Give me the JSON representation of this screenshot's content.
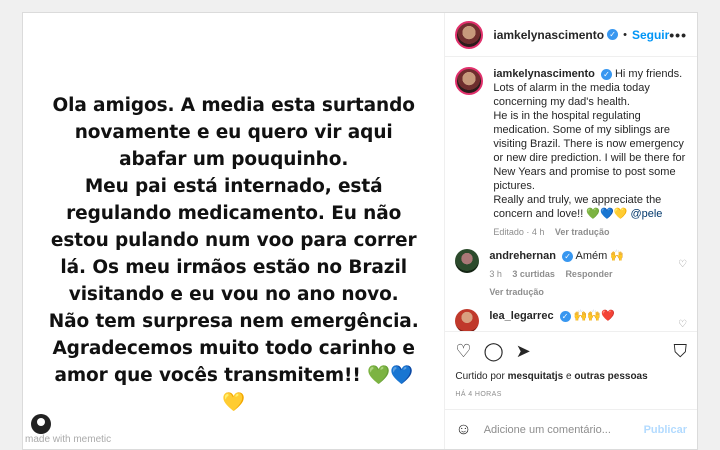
{
  "post": {
    "lines": [
      "Ola amigos. A media esta surtando",
      "novamente e eu quero vir aqui",
      "abafar um pouquinho.",
      "Meu pai está internado, está",
      "regulando medicamento. Eu não",
      "estou pulando num voo para correr",
      "lá. Os meu irmãos estão no Brazil",
      "visitando e eu vou no ano novo.",
      "Não tem surpresa nem emergência.",
      "Agradecemos muito todo carinho e",
      "amor que vocês transmitem!! 💚💙💛"
    ],
    "watermark": "made with memetic"
  },
  "header": {
    "username": "iamkelynascimento",
    "follow_label": "Seguir",
    "dot": "•",
    "more": "•••"
  },
  "caption": {
    "username": "iamkelynascimento",
    "text": "Hi my friends. Lots of alarm in the media today concerning my dad's health.\nHe is in the hospital regulating medication. Some of my siblings are visiting Brazil. There is now emergency or new dire prediction. I will be there for New Years and promise to post some pictures.\nReally and truly, we appreciate the concern and love!! 💚💙💛 ",
    "mention": "@pele",
    "edited": "Editado · 4 h",
    "translate": "Ver tradução"
  },
  "comments": [
    {
      "username": "andrehernan",
      "text": "Amém 🙌",
      "time": "3 h",
      "likes": "3 curtidas",
      "reply": "Responder",
      "translate": "Ver tradução"
    },
    {
      "username": "lea_legarrec",
      "text": "🙌🙌❤️"
    }
  ],
  "likes": {
    "prefix": "Curtido por ",
    "user": "mesquitatjs",
    "middle": " e ",
    "others": "outras pessoas"
  },
  "time_ago": "HÁ 4 HORAS",
  "add_comment": {
    "placeholder": "Adicione um comentário...",
    "publish": "Publicar"
  },
  "icons": {
    "heart": "heart-icon",
    "comment": "comment-icon",
    "share": "share-icon",
    "bookmark": "bookmark-icon",
    "emoji": "emoji-icon"
  }
}
